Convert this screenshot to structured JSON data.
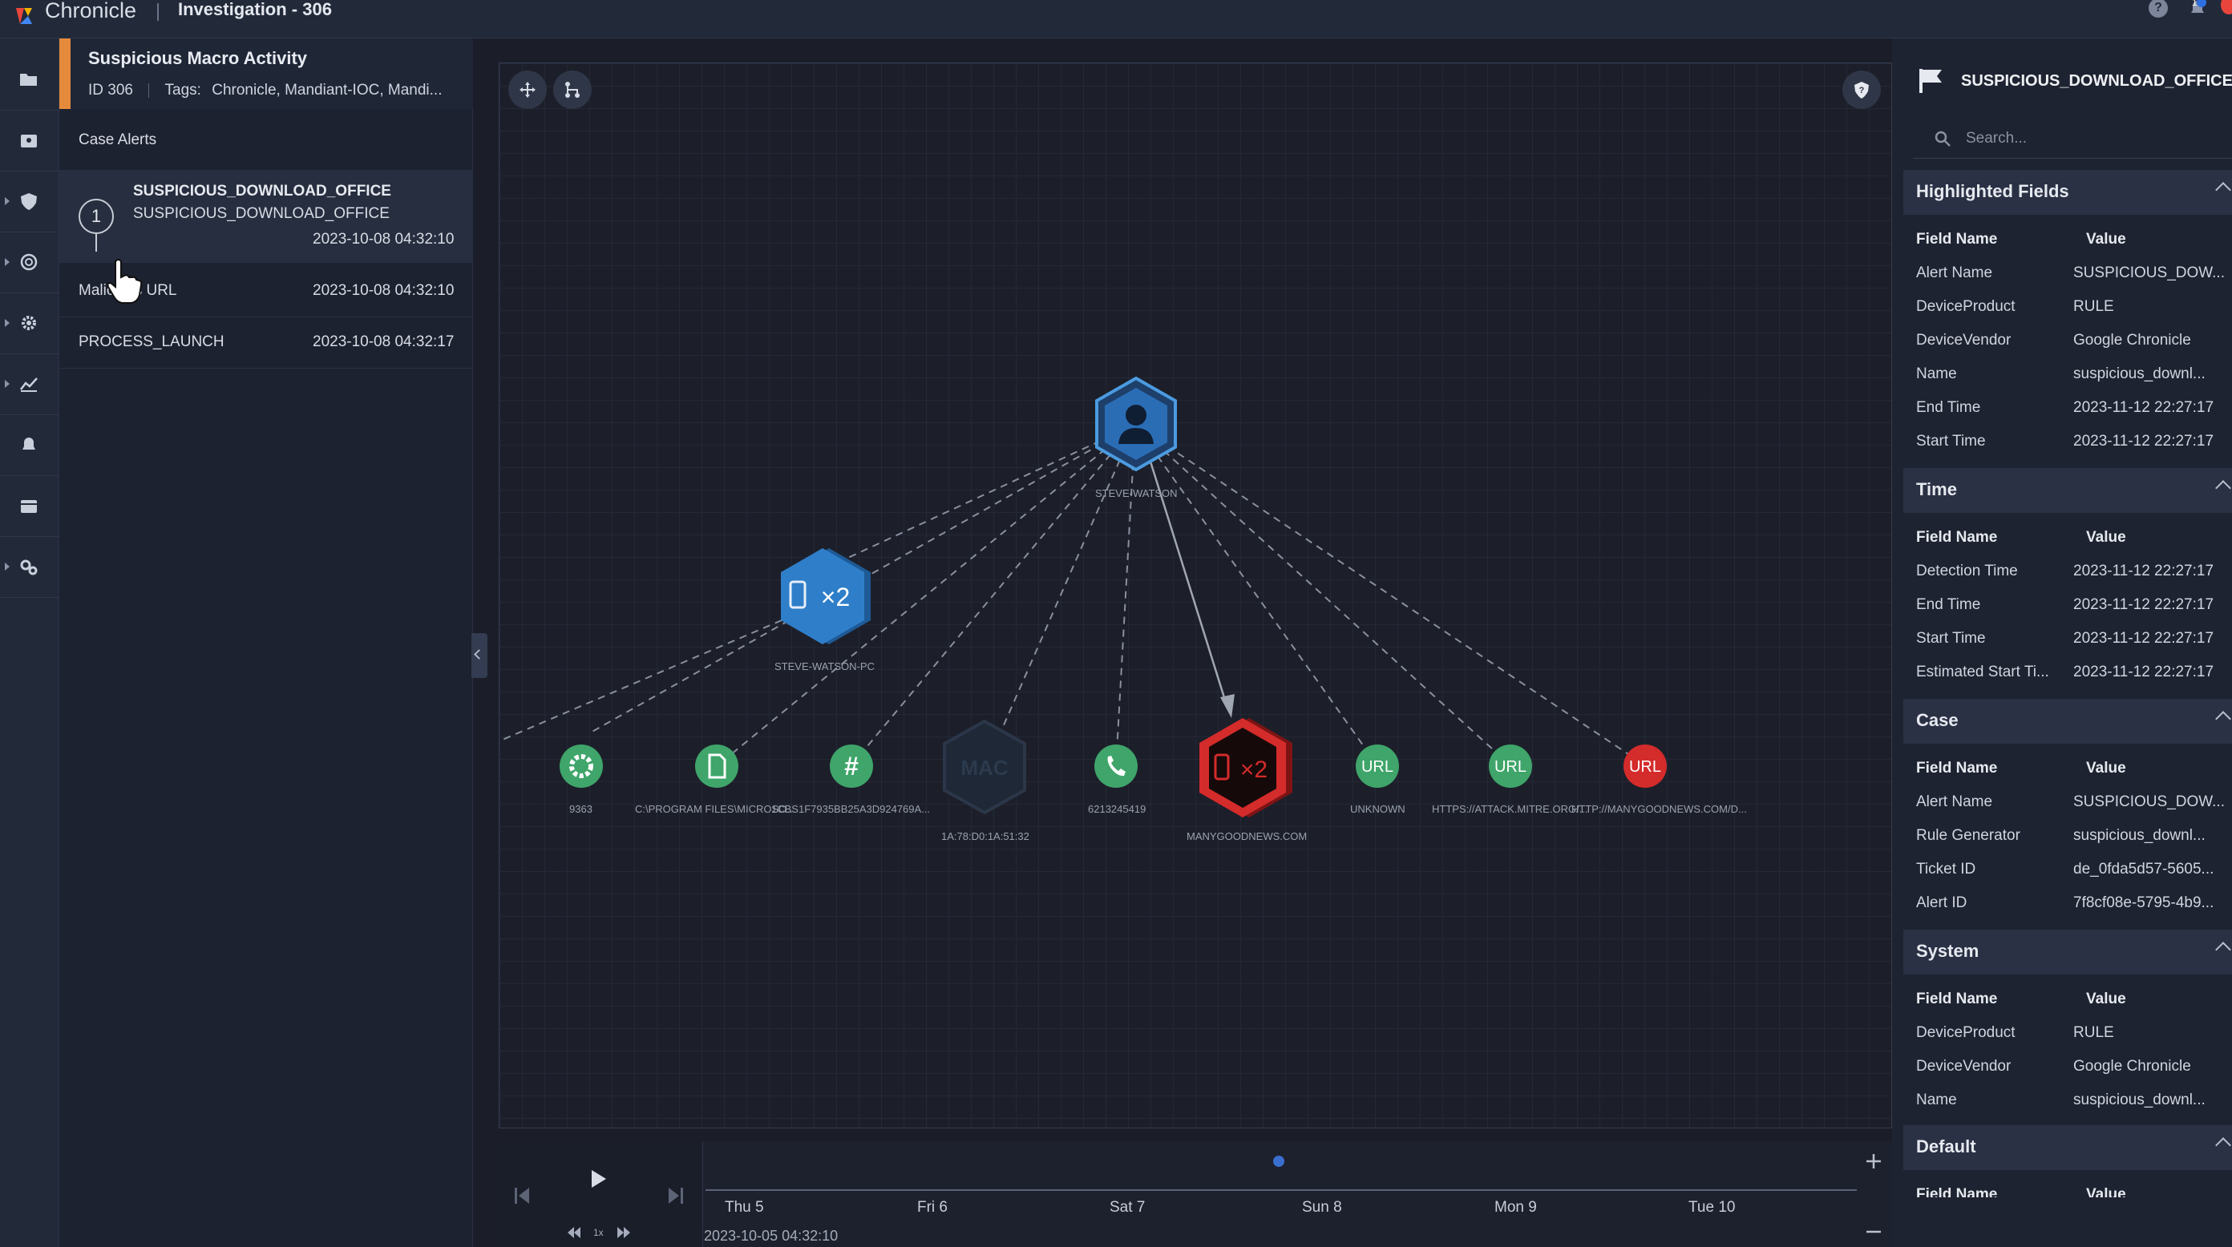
{
  "app": {
    "name": "Chronicle",
    "page_title": "Investigation - 306",
    "help_icon": "?",
    "notif_count": "1"
  },
  "case": {
    "title": "Suspicious Macro Activity",
    "id": "ID 306",
    "tags_label": "Tags:",
    "tags": "Chronicle, Mandiant-IOC, Mandi..."
  },
  "alerts": {
    "section_label": "Case Alerts",
    "items": [
      {
        "index": "1",
        "title": "SUSPICIOUS_DOWNLOAD_OFFICE",
        "subtitle": "SUSPICIOUS_DOWNLOAD_OFFICE",
        "time": "2023-10-08 04:32:10"
      },
      {
        "name": "Malicious URL",
        "time": "2023-10-08 04:32:10"
      },
      {
        "name": "PROCESS_LAUNCH",
        "time": "2023-10-08 04:32:17"
      }
    ]
  },
  "graph": {
    "nodes": [
      {
        "icon": "user-icon",
        "label": "STEVE-WATSON",
        "color": "#2a6db5"
      },
      {
        "icon": "device-icon",
        "badge": "×2",
        "label": "STEVE-WATSON-PC",
        "color": "#2f7ec9"
      },
      {
        "icon": "process-icon",
        "label": "9363",
        "color": "#3fa56a"
      },
      {
        "icon": "file-icon",
        "label": "C:\\PROGRAM FILES\\MICROSO...",
        "color": "#3fa56a"
      },
      {
        "icon": "hash-icon",
        "label": "1CBS1F7935BB25A3D924769A...",
        "color": "#3fa56a"
      },
      {
        "icon": "mac-icon",
        "text": "MAC",
        "label": "1A:78:D0:1A:51:32",
        "color": "#26303f"
      },
      {
        "icon": "phone-icon",
        "label": "6213245419",
        "color": "#3fa56a"
      },
      {
        "icon": "device-icon",
        "badge": "×2",
        "label": "MANYGOODNEWS.COM",
        "color": "#d42b2b"
      },
      {
        "icon": "url-icon",
        "text": "URL",
        "label": "UNKNOWN",
        "color": "#3fa56a"
      },
      {
        "icon": "url-icon",
        "text": "URL",
        "label": "HTTPS://ATTACK.MITRE.ORG/...",
        "color": "#3fa56a"
      },
      {
        "icon": "url-icon",
        "text": "URL",
        "label": "HTTP://MANYGOODNEWS.COM/D...",
        "color": "#d42b2b"
      }
    ]
  },
  "timeline": {
    "speed": "1x",
    "ticks": [
      "Thu 5",
      "Fri 6",
      "Sat 7",
      "Sun 8",
      "Mon 9",
      "Tue 10"
    ],
    "start": "2023-10-05 04:32:10"
  },
  "panel": {
    "title": "SUSPICIOUS_DOWNLOAD_OFFICE",
    "search_placeholder": "Search...",
    "col_field": "Field Name",
    "col_value": "Value",
    "sections": [
      {
        "title": "Highlighted Fields",
        "rows": [
          [
            "Alert Name",
            "SUSPICIOUS_DOW..."
          ],
          [
            "DeviceProduct",
            "RULE"
          ],
          [
            "DeviceVendor",
            "Google Chronicle"
          ],
          [
            "Name",
            "suspicious_downl..."
          ],
          [
            "End Time",
            "2023-11-12 22:27:17"
          ],
          [
            "Start Time",
            "2023-11-12 22:27:17"
          ]
        ]
      },
      {
        "title": "Time",
        "rows": [
          [
            "Detection Time",
            "2023-11-12 22:27:17"
          ],
          [
            "End Time",
            "2023-11-12 22:27:17"
          ],
          [
            "Start Time",
            "2023-11-12 22:27:17"
          ],
          [
            "Estimated Start Ti...",
            "2023-11-12 22:27:17"
          ]
        ]
      },
      {
        "title": "Case",
        "rows": [
          [
            "Alert Name",
            "SUSPICIOUS_DOW..."
          ],
          [
            "Rule Generator",
            "suspicious_downl..."
          ],
          [
            "Ticket ID",
            "de_0fda5d57-5605..."
          ],
          [
            "Alert ID",
            "7f8cf08e-5795-4b9..."
          ]
        ]
      },
      {
        "title": "System",
        "rows": [
          [
            "DeviceProduct",
            "RULE"
          ],
          [
            "DeviceVendor",
            "Google Chronicle"
          ],
          [
            "Name",
            "suspicious_downl..."
          ]
        ]
      },
      {
        "title": "Default",
        "rows": []
      }
    ]
  }
}
